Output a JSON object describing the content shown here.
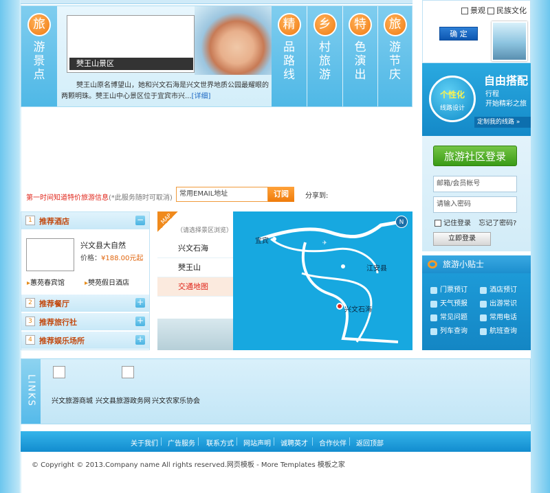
{
  "filter": {
    "options": [
      "景观",
      "民族文化"
    ],
    "confirm_label": "确 定"
  },
  "tour_panel": {
    "left_tab": {
      "badge": "旅",
      "text": "游景点"
    },
    "tabs": [
      {
        "badge": "精",
        "text": "品路线"
      },
      {
        "badge": "乡",
        "text": "村旅游"
      },
      {
        "badge": "特",
        "text": "色演出"
      },
      {
        "badge": "旅",
        "text": "游节庆"
      }
    ],
    "caption": "僰王山景区",
    "description": "僰王山原名博望山，她和兴文石海是兴文世界地质公园最耀眼的两颗明珠。僰王山中心景区位于宜宾市兴...",
    "more_label": "[详细]"
  },
  "route": {
    "circle_title": "个性化",
    "circle_sub": "线路设计",
    "title": "自由搭配",
    "sub1": "行程",
    "sub2": "开始精彩之旅",
    "link": "定制我的线路 »"
  },
  "login": {
    "header": "旅游社区登录",
    "account_placeholder": "邮箱/会员帐号",
    "password_placeholder": "请输入密码",
    "remember_label": "记住登录",
    "forgot_label": "忘记了密码?",
    "login_button": "立即登录"
  },
  "tips": {
    "title": "旅游小贴士",
    "items": [
      "门票预订",
      "酒店预订",
      "天气预报",
      "出游常识",
      "常见问题",
      "常用电话",
      "列车查询",
      "航班查询"
    ]
  },
  "subscribe": {
    "notice": "第一时间知道特价旅游信息",
    "notice_note": "(*此服务随时可取消)",
    "email_placeholder": "常用EMAIL地址",
    "button": "订阅",
    "share_label": "分享到:"
  },
  "recommend": {
    "sections": [
      {
        "num": "1",
        "label": "推荐酒店",
        "toggle": "−"
      },
      {
        "num": "2",
        "label": "推荐餐厅",
        "toggle": "+"
      },
      {
        "num": "3",
        "label": "推荐旅行社",
        "toggle": "+"
      },
      {
        "num": "4",
        "label": "推荐娱乐场所",
        "toggle": "+"
      }
    ],
    "hotel_name": "兴文县大自然",
    "price_label": "价格：",
    "price": "¥188.00元起",
    "links": [
      "蕙苑春宾馆",
      "僰苑假日酒店"
    ]
  },
  "map": {
    "badge": "MAP",
    "hint": "（请选择景区浏览）",
    "items": [
      "兴文石海",
      "僰王山",
      "交通地图"
    ],
    "labels": [
      "宜宾",
      "江安县",
      "兴文石海"
    ],
    "compass": "N"
  },
  "links": {
    "label": "LINKS",
    "items": [
      "兴文旅游商城",
      "兴文县旅游政务网",
      "兴文农家乐协会"
    ]
  },
  "footer": {
    "nav": [
      "关于我们",
      "广告服务",
      "联系方式",
      "网站声明",
      "诚聘英才",
      "合作伙伴",
      "返回顶部"
    ],
    "copyright": "© Copyright © 2013.Company name All rights reserved.网页模板 - More Templates 模板之家"
  }
}
